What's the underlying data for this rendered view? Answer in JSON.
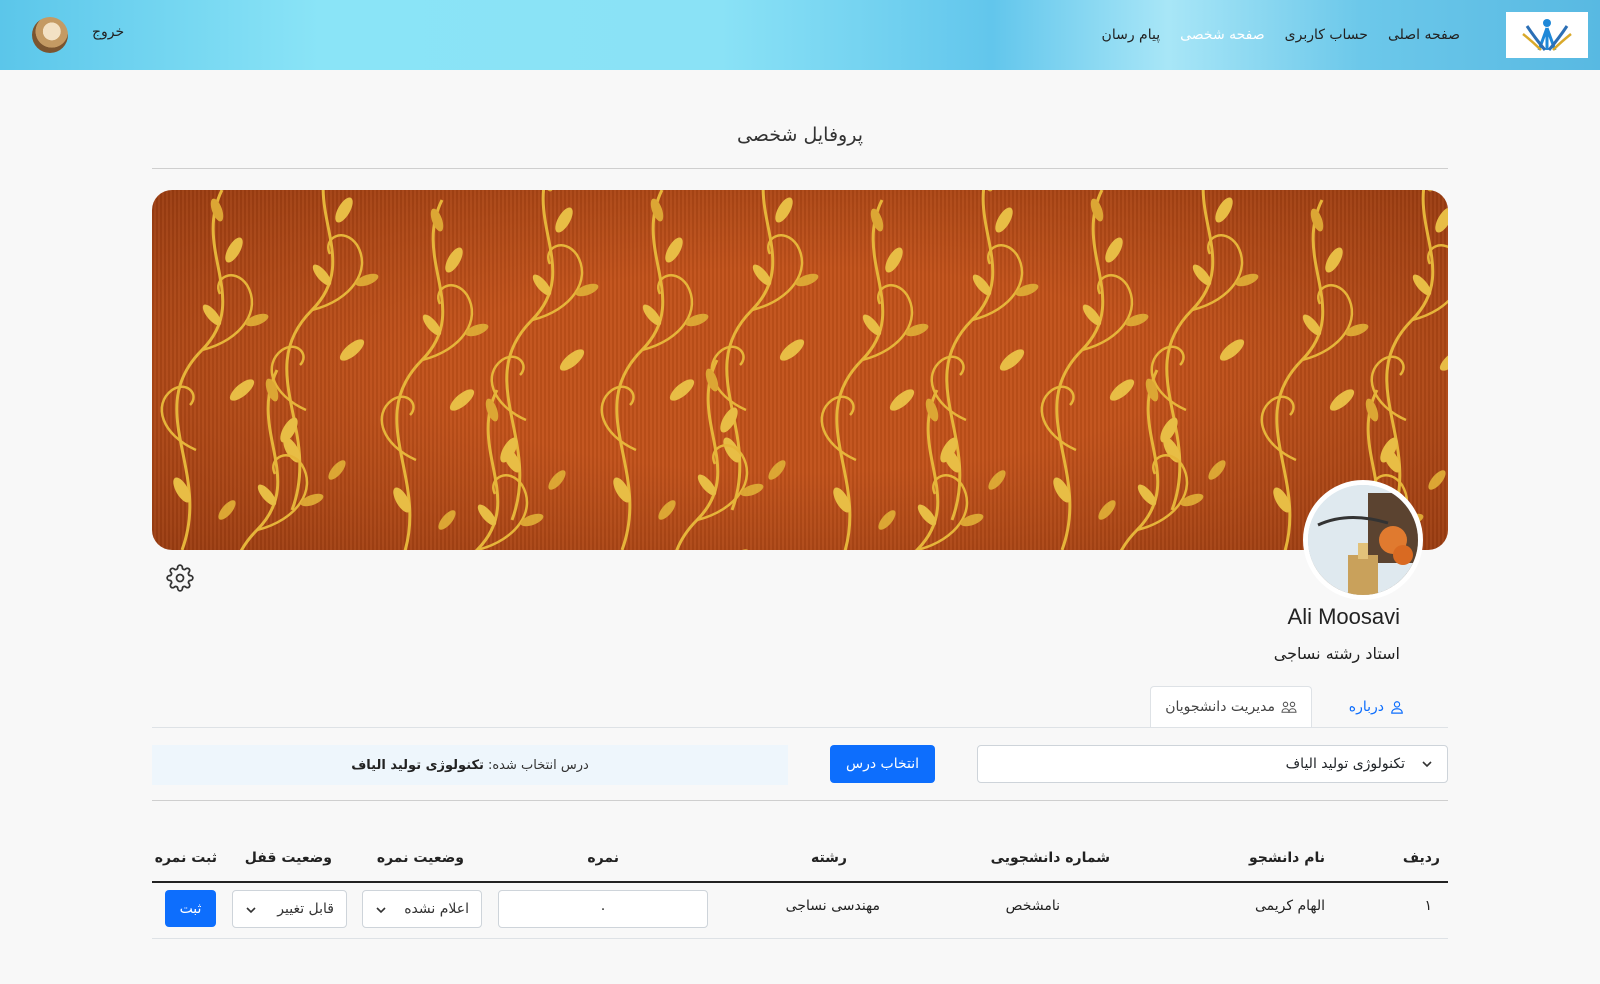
{
  "nav": {
    "links": [
      "صفحه اصلی",
      "حساب کاربری",
      "صفحه شخصی",
      "پیام رسان"
    ],
    "active_index": 2,
    "logout": "خروج"
  },
  "page": {
    "title": "پروفایل شخصی"
  },
  "profile": {
    "name": "Ali Moosavi",
    "role": "استاد رشته نساجی"
  },
  "tabs": {
    "about": "درباره",
    "students": "مدیریت دانشجویان"
  },
  "course": {
    "select_value": "تکنولوژی تولید الیاف",
    "select_button": "انتخاب درس",
    "selected_label": "درس انتخاب شده:",
    "selected_value": "تکنولوژی تولید الیاف"
  },
  "table": {
    "headers": [
      "ردیف",
      "نام دانشجو",
      "شماره دانشجویی",
      "رشته",
      "نمره",
      "وضعیت نمره",
      "وضعیت قفل",
      "ثبت نمره"
    ],
    "rows": [
      {
        "index": "۱",
        "name": "الهام کریمی",
        "student_no": "نامشخص",
        "major": "مهندسی نساجی",
        "grade": "۰",
        "grade_status": "اعلام نشده",
        "lock_status": "قابل تغییر",
        "submit": "ثبت"
      }
    ]
  },
  "colors": {
    "primary": "#0d6efd",
    "cover": "#c2521a",
    "ornament": "#e8b93a"
  }
}
